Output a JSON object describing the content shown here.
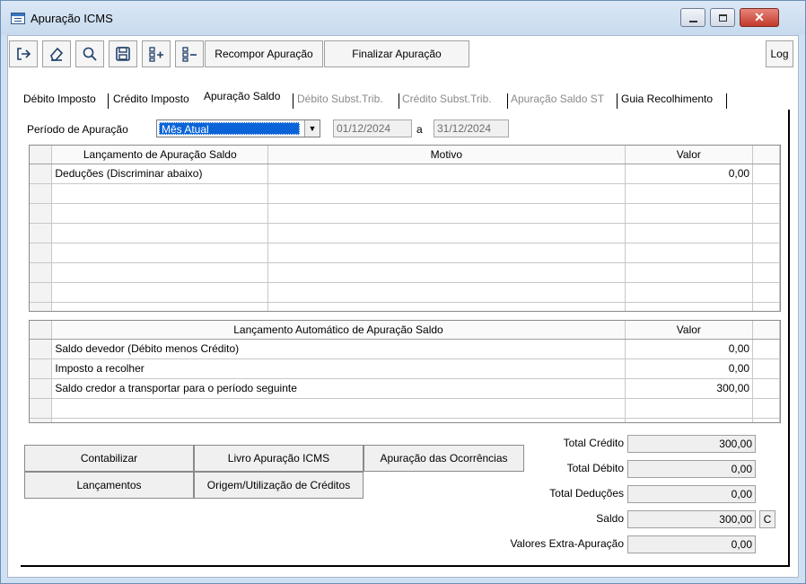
{
  "window": {
    "title": "Apuração ICMS"
  },
  "toolbar": {
    "recompor_label": "Recompor Apuração",
    "finalizar_label": "Finalizar Apuração",
    "log_label": "Log"
  },
  "tabs": [
    {
      "label": "Débito Imposto",
      "state": "normal"
    },
    {
      "label": "Crédito Imposto",
      "state": "normal"
    },
    {
      "label": "Apuração Saldo",
      "state": "active"
    },
    {
      "label": "Débito Subst.Trib.",
      "state": "disabled"
    },
    {
      "label": "Crédito Subst.Trib.",
      "state": "disabled"
    },
    {
      "label": "Apuração Saldo ST",
      "state": "disabled"
    },
    {
      "label": "Guia Recolhimento",
      "state": "normal"
    }
  ],
  "periodo": {
    "label": "Período de  Apuração",
    "selected": "Mês Atual",
    "date_from": "01/12/2024",
    "date_sep": "a",
    "date_to": "31/12/2024"
  },
  "grid1": {
    "headers": [
      "Lançamento de Apuração Saldo",
      "Motivo",
      "Valor"
    ],
    "rows": [
      [
        "Deduções (Discriminar abaixo)",
        "",
        "0,00"
      ],
      [
        "",
        "",
        ""
      ],
      [
        "",
        "",
        ""
      ],
      [
        "",
        "",
        ""
      ],
      [
        "",
        "",
        ""
      ],
      [
        "",
        "",
        ""
      ],
      [
        "",
        "",
        ""
      ],
      [
        "",
        "",
        ""
      ]
    ]
  },
  "grid2": {
    "headers": [
      "Lançamento Automático de Apuração Saldo",
      "Valor"
    ],
    "rows": [
      [
        "Saldo devedor (Débito menos Crédito)",
        "0,00"
      ],
      [
        "Imposto a recolher",
        "0,00"
      ],
      [
        "Saldo credor a transportar para o período seguinte",
        "300,00"
      ],
      [
        "",
        ""
      ],
      [
        "",
        ""
      ]
    ]
  },
  "actions": {
    "contabilizar": "Contabilizar",
    "livro": "Livro Apuração ICMS",
    "ocorrencias": "Apuração das Ocorrências",
    "lancamentos": "Lançamentos",
    "origem": "Origem/Utilização de Créditos"
  },
  "totals": {
    "credito_label": "Total Crédito",
    "credito": "300,00",
    "debito_label": "Total Débito",
    "debito": "0,00",
    "deducoes_label": "Total Deduções",
    "deducoes": "0,00",
    "saldo_label": "Saldo",
    "saldo": "300,00",
    "saldo_tipo": "C",
    "extra_label": "Valores Extra-Apuração",
    "extra": "0,00"
  }
}
